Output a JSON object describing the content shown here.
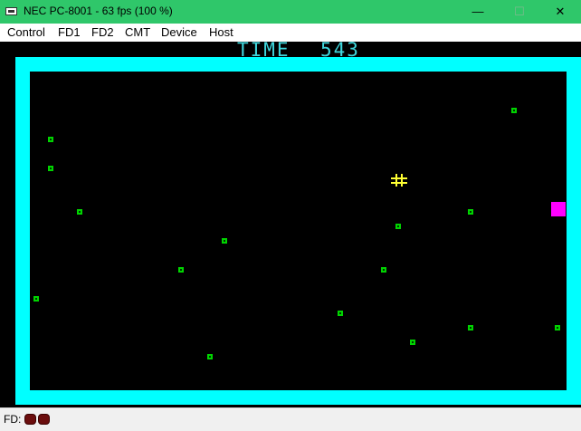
{
  "window": {
    "title": "NEC PC-8001 - 63 fps (100 %)",
    "app_icon": "pc-8001-icon",
    "controls": {
      "minimize": "—",
      "maximize": "☐",
      "close": "✕"
    }
  },
  "menu": [
    {
      "label": "Control"
    },
    {
      "label": "FD1"
    },
    {
      "label": "FD2"
    },
    {
      "label": "CMT"
    },
    {
      "label": "Device"
    },
    {
      "label": "Host"
    }
  ],
  "game": {
    "time_label": "TIME",
    "time_value": "543",
    "colors": {
      "border": "#00ffff",
      "dot": "#00d400",
      "player": "#ffff33",
      "enemy": "#ff00ff",
      "text": "#3fd6dc"
    }
  },
  "status": {
    "fd_label": "FD:",
    "drives": [
      {
        "state": "off"
      },
      {
        "state": "off"
      }
    ]
  }
}
